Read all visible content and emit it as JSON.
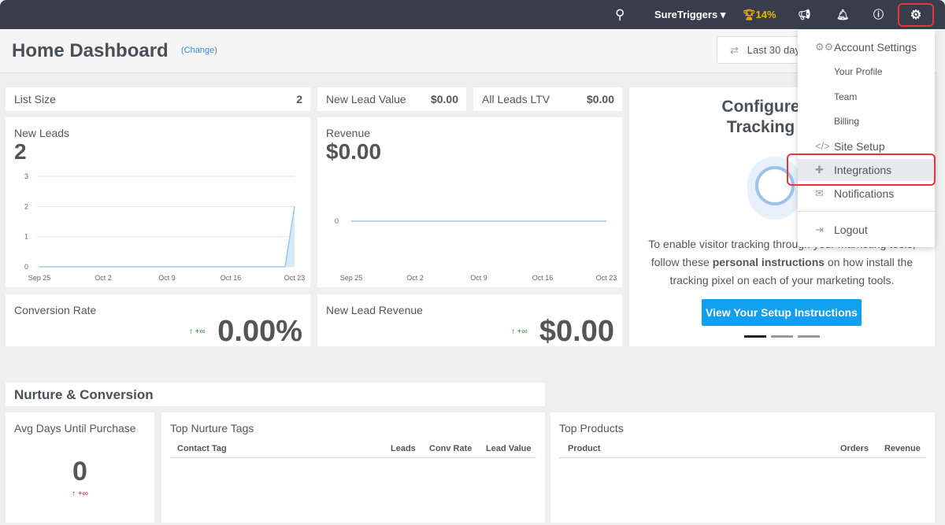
{
  "topbar": {
    "account": "SureTriggers",
    "progress": "14%",
    "icons": [
      "search-icon",
      "trophy-icon",
      "megaphone-icon",
      "bell-icon",
      "help-icon",
      "gear-icon"
    ]
  },
  "header": {
    "title": "Home Dashboard",
    "change": "(Change)",
    "date_range": "Last 30 days"
  },
  "stats": {
    "list_size_label": "List Size",
    "list_size": "2",
    "new_lead_value_label": "New Lead Value",
    "new_lead_value": "$0.00",
    "all_leads_ltv_label": "All Leads LTV",
    "all_leads_ltv": "$0.00"
  },
  "new_leads": {
    "label": "New Leads",
    "value": "2"
  },
  "revenue": {
    "label": "Revenue",
    "value": "$0.00"
  },
  "conversion": {
    "label": "Conversion Rate",
    "value": "0.00%",
    "change": "+∞"
  },
  "new_lead_revenue": {
    "label": "New Lead Revenue",
    "value": "$0.00",
    "change": "+∞"
  },
  "tracking": {
    "title1": "Configure",
    "title2": "Tracking",
    "text1": "To enable visitor tracking through your marketing tools,",
    "text2a": "follow these ",
    "text2b": "personal instructions",
    "text2c": " on how install the",
    "text3": "tracking pixel on each of your marketing tools.",
    "button": "View Your Setup Instructions"
  },
  "nurture": {
    "title": "Nurture & Conversion",
    "avg_label": "Avg Days Until Purchase",
    "avg_value": "0",
    "avg_change": "+∞",
    "tags_title": "Top Nurture Tags",
    "tags_cols": [
      "Contact Tag",
      "Leads",
      "Conv Rate",
      "Lead Value"
    ],
    "products_title": "Top Products",
    "products_cols": [
      "Product",
      "Orders",
      "Revenue"
    ]
  },
  "menu": {
    "account_settings": "Account Settings",
    "your_profile": "Your Profile",
    "team": "Team",
    "billing": "Billing",
    "site_setup": "Site Setup",
    "integrations": "Integrations",
    "notifications": "Notifications",
    "logout": "Logout"
  },
  "chart_data": [
    {
      "type": "line",
      "x": [
        "Sep 25",
        "Oct 2",
        "Oct 9",
        "Oct 16",
        "Oct 23"
      ],
      "y_ticks": [
        0,
        1,
        2,
        3
      ],
      "ylim": [
        0,
        3
      ],
      "values_note_points": [
        [
          0,
          0
        ],
        [
          27,
          0
        ],
        [
          28,
          2
        ]
      ],
      "series": [
        {
          "values": [
            0,
            0,
            0,
            0,
            2
          ]
        }
      ]
    },
    {
      "type": "line",
      "x": [
        "Sep 25",
        "Oct 2",
        "Oct 9",
        "Oct 16",
        "Oct 23"
      ],
      "y_ticks": [
        0
      ],
      "series": [
        {
          "values": [
            0,
            0,
            0,
            0,
            0
          ]
        }
      ]
    }
  ],
  "colors": {
    "topbar": "#383d4c",
    "accent": "#11a0f0",
    "highlight": "#e8323c",
    "trophy": "#f0b400",
    "up": "#2a8a2a",
    "up_red": "#c0283c"
  }
}
